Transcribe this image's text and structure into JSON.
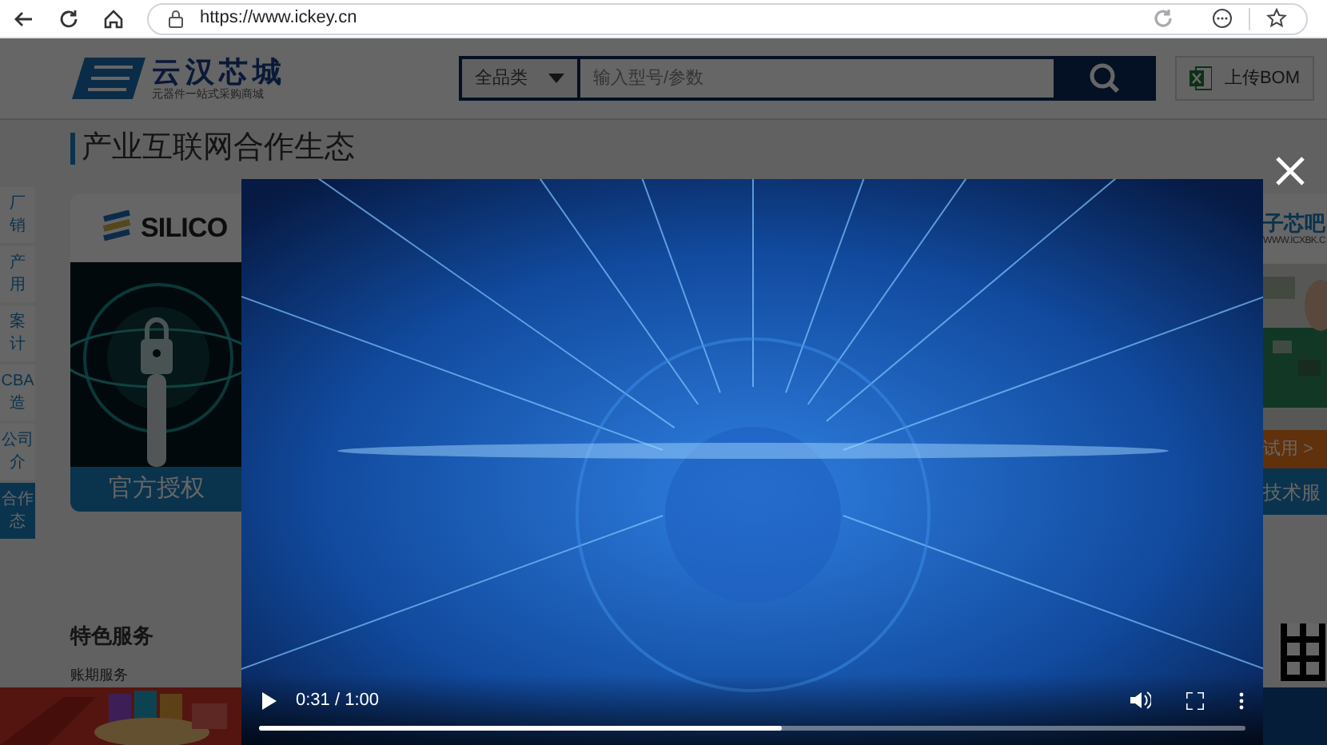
{
  "browser": {
    "url": "https://www.ickey.cn"
  },
  "header": {
    "logo_name": "云汉芯城",
    "logo_tagline": "元器件一站式采购商城",
    "search": {
      "category": "全品类",
      "placeholder": "输入型号/参数"
    },
    "bom_button": "上传BOM"
  },
  "section_title": "产业互联网合作生态",
  "side_tabs": [
    {
      "lines": [
        "厂",
        "销"
      ],
      "selected": false
    },
    {
      "lines": [
        "产",
        "用"
      ],
      "selected": false
    },
    {
      "lines": [
        "案",
        "计"
      ],
      "selected": false
    },
    {
      "lines": [
        "CBA",
        "造"
      ],
      "selected": false
    },
    {
      "lines": [
        "公司",
        "介"
      ],
      "selected": false
    },
    {
      "lines": [
        "合作",
        "态"
      ],
      "selected": true
    }
  ],
  "cards": [
    {
      "logo": "SILICO",
      "footer": "官方授权"
    },
    {
      "logo": "子芯吧",
      "url": "WWW.ICXBK.C",
      "badge": "试用 >",
      "footer": "技术服"
    }
  ],
  "services": {
    "title": "特色服务",
    "item": "账期服务"
  },
  "video": {
    "playing": false,
    "time": "0:31 / 1:00",
    "level": 0.53
  }
}
